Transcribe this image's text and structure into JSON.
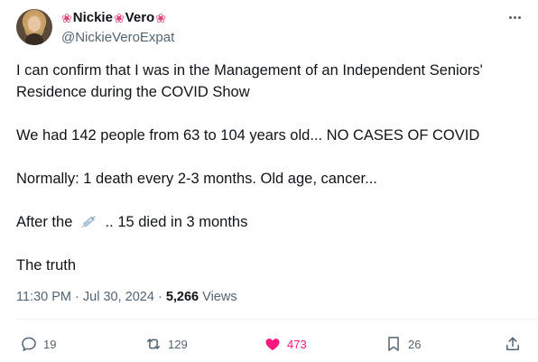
{
  "author": {
    "name_parts": [
      "Nickie",
      "Vero"
    ],
    "flower_glyph": "❀",
    "handle": "@NickieVeroExpat"
  },
  "tweet": {
    "lines": [
      "I can confirm that I was in the Management of an Independent Seniors' Residence during the COVID Show",
      "We had 142 people from 63 to 104 years old... NO CASES OF COVID",
      "Normally: 1 death every 2-3 months. Old age, cancer...",
      "After the",
      ".. 15 died in 3 months",
      "The truth"
    ],
    "inline_icon": "syringe-emoji"
  },
  "meta": {
    "time": "11:30 PM",
    "date": "Jul 30, 2024",
    "separator": "·",
    "views_count": "5,266",
    "views_label": "Views"
  },
  "actions": {
    "replies": "19",
    "reposts": "129",
    "likes": "473",
    "bookmarks": "26"
  },
  "colors": {
    "text": "#0f1419",
    "secondary": "#536471",
    "like": "#f91880",
    "flower": "#e0457b"
  }
}
